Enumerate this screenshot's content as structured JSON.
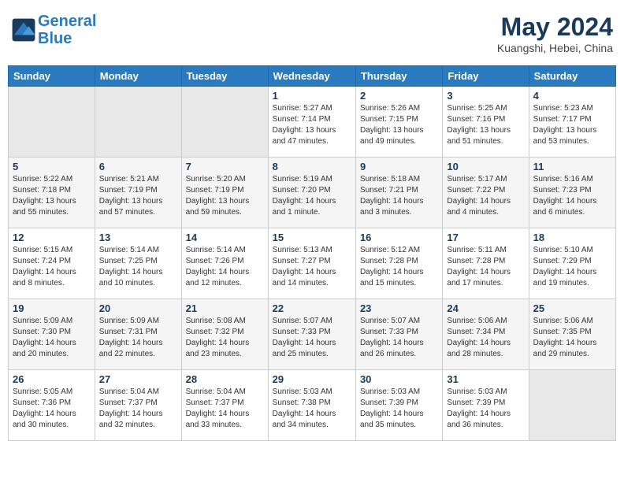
{
  "header": {
    "logo_line1": "General",
    "logo_line2": "Blue",
    "month_title": "May 2024",
    "subtitle": "Kuangshi, Hebei, China"
  },
  "days_of_week": [
    "Sunday",
    "Monday",
    "Tuesday",
    "Wednesday",
    "Thursday",
    "Friday",
    "Saturday"
  ],
  "weeks": [
    [
      {
        "day": "",
        "info": ""
      },
      {
        "day": "",
        "info": ""
      },
      {
        "day": "",
        "info": ""
      },
      {
        "day": "1",
        "info": "Sunrise: 5:27 AM\nSunset: 7:14 PM\nDaylight: 13 hours\nand 47 minutes."
      },
      {
        "day": "2",
        "info": "Sunrise: 5:26 AM\nSunset: 7:15 PM\nDaylight: 13 hours\nand 49 minutes."
      },
      {
        "day": "3",
        "info": "Sunrise: 5:25 AM\nSunset: 7:16 PM\nDaylight: 13 hours\nand 51 minutes."
      },
      {
        "day": "4",
        "info": "Sunrise: 5:23 AM\nSunset: 7:17 PM\nDaylight: 13 hours\nand 53 minutes."
      }
    ],
    [
      {
        "day": "5",
        "info": "Sunrise: 5:22 AM\nSunset: 7:18 PM\nDaylight: 13 hours\nand 55 minutes."
      },
      {
        "day": "6",
        "info": "Sunrise: 5:21 AM\nSunset: 7:19 PM\nDaylight: 13 hours\nand 57 minutes."
      },
      {
        "day": "7",
        "info": "Sunrise: 5:20 AM\nSunset: 7:19 PM\nDaylight: 13 hours\nand 59 minutes."
      },
      {
        "day": "8",
        "info": "Sunrise: 5:19 AM\nSunset: 7:20 PM\nDaylight: 14 hours\nand 1 minute."
      },
      {
        "day": "9",
        "info": "Sunrise: 5:18 AM\nSunset: 7:21 PM\nDaylight: 14 hours\nand 3 minutes."
      },
      {
        "day": "10",
        "info": "Sunrise: 5:17 AM\nSunset: 7:22 PM\nDaylight: 14 hours\nand 4 minutes."
      },
      {
        "day": "11",
        "info": "Sunrise: 5:16 AM\nSunset: 7:23 PM\nDaylight: 14 hours\nand 6 minutes."
      }
    ],
    [
      {
        "day": "12",
        "info": "Sunrise: 5:15 AM\nSunset: 7:24 PM\nDaylight: 14 hours\nand 8 minutes."
      },
      {
        "day": "13",
        "info": "Sunrise: 5:14 AM\nSunset: 7:25 PM\nDaylight: 14 hours\nand 10 minutes."
      },
      {
        "day": "14",
        "info": "Sunrise: 5:14 AM\nSunset: 7:26 PM\nDaylight: 14 hours\nand 12 minutes."
      },
      {
        "day": "15",
        "info": "Sunrise: 5:13 AM\nSunset: 7:27 PM\nDaylight: 14 hours\nand 14 minutes."
      },
      {
        "day": "16",
        "info": "Sunrise: 5:12 AM\nSunset: 7:28 PM\nDaylight: 14 hours\nand 15 minutes."
      },
      {
        "day": "17",
        "info": "Sunrise: 5:11 AM\nSunset: 7:28 PM\nDaylight: 14 hours\nand 17 minutes."
      },
      {
        "day": "18",
        "info": "Sunrise: 5:10 AM\nSunset: 7:29 PM\nDaylight: 14 hours\nand 19 minutes."
      }
    ],
    [
      {
        "day": "19",
        "info": "Sunrise: 5:09 AM\nSunset: 7:30 PM\nDaylight: 14 hours\nand 20 minutes."
      },
      {
        "day": "20",
        "info": "Sunrise: 5:09 AM\nSunset: 7:31 PM\nDaylight: 14 hours\nand 22 minutes."
      },
      {
        "day": "21",
        "info": "Sunrise: 5:08 AM\nSunset: 7:32 PM\nDaylight: 14 hours\nand 23 minutes."
      },
      {
        "day": "22",
        "info": "Sunrise: 5:07 AM\nSunset: 7:33 PM\nDaylight: 14 hours\nand 25 minutes."
      },
      {
        "day": "23",
        "info": "Sunrise: 5:07 AM\nSunset: 7:33 PM\nDaylight: 14 hours\nand 26 minutes."
      },
      {
        "day": "24",
        "info": "Sunrise: 5:06 AM\nSunset: 7:34 PM\nDaylight: 14 hours\nand 28 minutes."
      },
      {
        "day": "25",
        "info": "Sunrise: 5:06 AM\nSunset: 7:35 PM\nDaylight: 14 hours\nand 29 minutes."
      }
    ],
    [
      {
        "day": "26",
        "info": "Sunrise: 5:05 AM\nSunset: 7:36 PM\nDaylight: 14 hours\nand 30 minutes."
      },
      {
        "day": "27",
        "info": "Sunrise: 5:04 AM\nSunset: 7:37 PM\nDaylight: 14 hours\nand 32 minutes."
      },
      {
        "day": "28",
        "info": "Sunrise: 5:04 AM\nSunset: 7:37 PM\nDaylight: 14 hours\nand 33 minutes."
      },
      {
        "day": "29",
        "info": "Sunrise: 5:03 AM\nSunset: 7:38 PM\nDaylight: 14 hours\nand 34 minutes."
      },
      {
        "day": "30",
        "info": "Sunrise: 5:03 AM\nSunset: 7:39 PM\nDaylight: 14 hours\nand 35 minutes."
      },
      {
        "day": "31",
        "info": "Sunrise: 5:03 AM\nSunset: 7:39 PM\nDaylight: 14 hours\nand 36 minutes."
      },
      {
        "day": "",
        "info": ""
      }
    ]
  ]
}
